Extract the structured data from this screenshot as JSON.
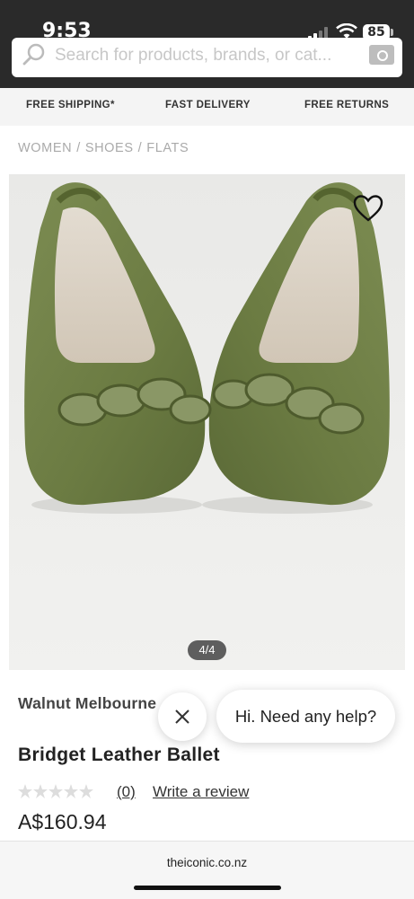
{
  "status_bar": {
    "time": "9:53",
    "battery": "85"
  },
  "search": {
    "placeholder": "Search for products, brands, or cat..."
  },
  "benefits": [
    "FREE SHIPPING*",
    "FAST DELIVERY",
    "FREE RETURNS"
  ],
  "breadcrumb": [
    "WOMEN",
    "SHOES",
    "FLATS"
  ],
  "gallery": {
    "counter": "4/4",
    "shoe_color": "#6f7f47"
  },
  "product": {
    "brand": "Walnut Melbourne",
    "title": "Bridget Leather Ballet",
    "rating": 0,
    "review_count": "(0)",
    "write_review": "Write a review",
    "price": "A$160.94"
  },
  "chat": {
    "message": "Hi. Need any help?"
  },
  "browser": {
    "url": "theiconic.co.nz"
  },
  "icons": [
    "search-icon",
    "camera-icon",
    "heart-icon",
    "close-icon",
    "chevron-right-icon",
    "star-icon",
    "wifi-icon",
    "signal-icon",
    "battery-icon"
  ]
}
